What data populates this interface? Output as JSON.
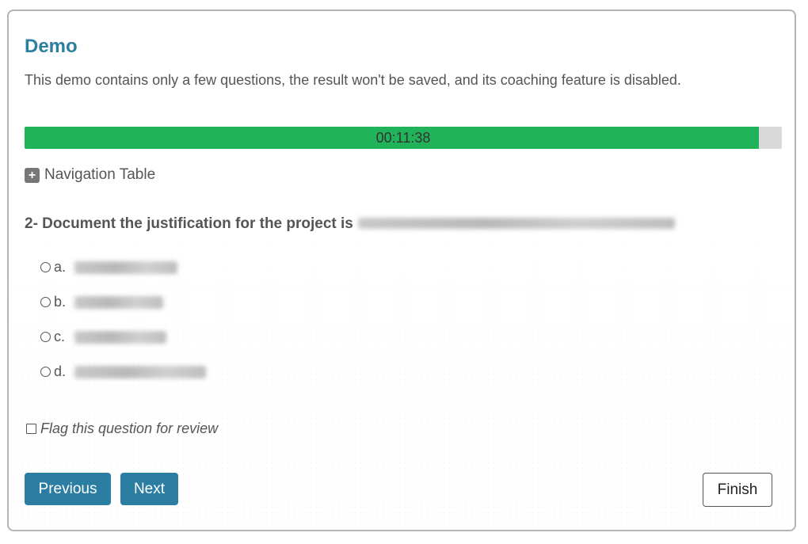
{
  "header": {
    "title": "Demo",
    "description": "This demo contains only a few questions, the result won't be saved, and its coaching feature is disabled."
  },
  "timer": {
    "text": "00:11:38",
    "progress_fraction": 0.97,
    "fill_color": "#21b359",
    "track_color": "#d9d9d9"
  },
  "navigation": {
    "toggle_icon": "plus-icon",
    "label": "Navigation Table"
  },
  "question": {
    "prefix": "2- Document the justification for the project is",
    "options": [
      {
        "letter": "a."
      },
      {
        "letter": "b."
      },
      {
        "letter": "c."
      },
      {
        "letter": "d."
      }
    ]
  },
  "flag": {
    "label": "Flag this question for review",
    "checked": false
  },
  "buttons": {
    "previous": "Previous",
    "next": "Next",
    "finish": "Finish"
  },
  "colors": {
    "accent": "#2e7ea0",
    "button_primary": "#2b7ea2",
    "text": "#555555"
  }
}
